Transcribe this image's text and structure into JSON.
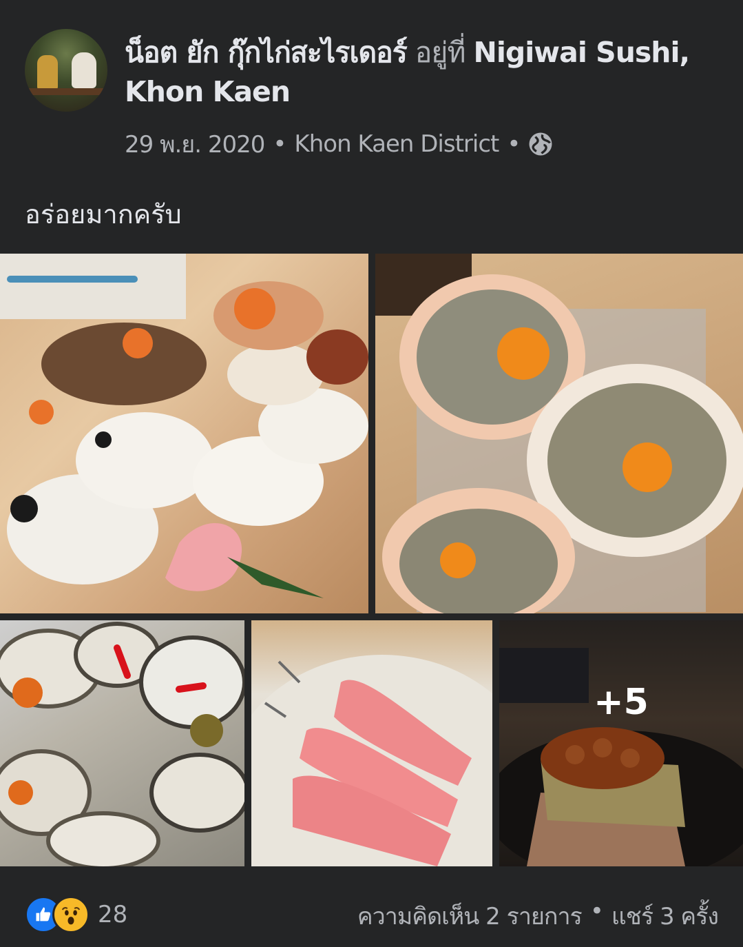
{
  "post": {
    "author_name": "น็อต ยัก กุ๊กไก่สะไรเดอร์",
    "at_text": "อยู่ที่",
    "place_name": "Nigiwai Sushi, Khon Kaen",
    "date": "29 พ.ย. 2020",
    "separator": "•",
    "location": "Khon Kaen District",
    "privacy_icon": "globe-icon",
    "caption": "อร่อยมากครับ"
  },
  "photos": {
    "items": [
      {
        "name": "sushi-platter-photo"
      },
      {
        "name": "crab-shell-photo"
      },
      {
        "name": "oysters-photo"
      },
      {
        "name": "tuna-sashimi-photo"
      },
      {
        "name": "ikura-nigiri-photo"
      }
    ],
    "more_label": "+5"
  },
  "footer": {
    "reaction_icons": [
      "like-icon",
      "wow-icon"
    ],
    "reaction_count": "28",
    "comments": "ความคิดเห็น 2 รายการ",
    "separator": "•",
    "shares": "แชร์ 3 ครั้ง"
  },
  "colors": {
    "background": "#242526",
    "primary_text": "#e4e6eb",
    "secondary_text": "#b0b3b8",
    "like_blue": "#1877f2",
    "wow_yellow": "#f7b928"
  }
}
